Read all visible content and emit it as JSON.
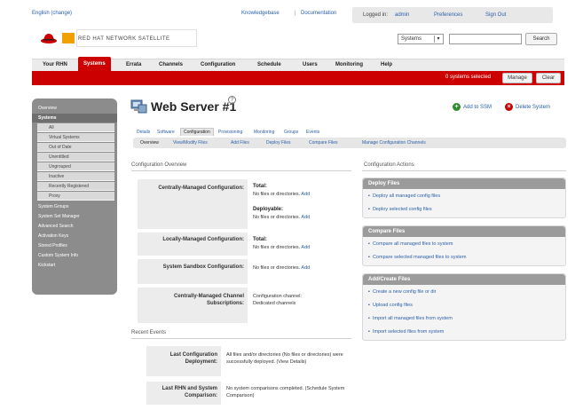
{
  "topbar": {
    "language": "English (change)",
    "knowledgebase": "Knowledgebase",
    "documentation": "Documentation",
    "separator": "|",
    "logged_in": "Logged in:",
    "user": "admin",
    "preferences": "Preferences",
    "sign_out": "Sign Out"
  },
  "brand": {
    "logo_text": "RED HAT NETWORK SATELLITE"
  },
  "search": {
    "scope": "Systems",
    "button": "Search"
  },
  "mainnav": {
    "tabs": [
      "Your RHN",
      "Systems",
      "Errata",
      "Channels",
      "Configuration",
      "Schedule",
      "Users",
      "Monitoring",
      "Help"
    ]
  },
  "redbar": {
    "selected": "0 systems selected",
    "manage": "Manage",
    "clear": "Clear"
  },
  "sidebar": {
    "items": [
      "Overview",
      "Systems"
    ],
    "subitems": [
      "All",
      "Virtual Systems",
      "Out of Date",
      "Unentitled",
      "Ungrouped",
      "Inactive",
      "Recently Registered",
      "Proxy"
    ],
    "more": [
      "System Groups",
      "System Set Manager",
      "Advanced Search",
      "Activation Keys",
      "Stored Profiles",
      "Custom System Info",
      "Kickstart"
    ]
  },
  "server": {
    "title": "Web Server #1",
    "help": "?",
    "add_to_ssm": "Add to SSM",
    "delete_system": "Delete System"
  },
  "tabs1": [
    "Details",
    "Software",
    "Configuration",
    "Provisioning",
    "Monitoring",
    "Groups",
    "Events"
  ],
  "tabs2": [
    "Overview",
    "View/Modify Files",
    "Add Files",
    "Deploy Files",
    "Compare Files",
    "Manage Configuration Channels"
  ],
  "overview": {
    "heading": "Configuration Overview",
    "rows": [
      {
        "label": "Centrally-Managed Configuration:",
        "total_label": "Total:",
        "total_value": "No files or directories.",
        "total_link": "Add",
        "deploy_label": "Deployable:",
        "deploy_value": "No files or directories.",
        "deploy_link": "Add"
      },
      {
        "label": "Locally-Managed Configuration:",
        "total_label": "Total:",
        "value": "No files or directories.",
        "link": "Add"
      },
      {
        "label": "System Sandbox Configuration:",
        "value": "No files or directories.",
        "link": "Add"
      },
      {
        "label": "Centrally-Managed Channel Subscriptions:",
        "value": "Configuration channel: Dedicated channels"
      }
    ]
  },
  "events": {
    "heading": "Recent Events",
    "rows": [
      {
        "label": "Last Configuration Deployment:",
        "value": "All files and/or directories (No files or directories) were successfully deployed. (View Details)"
      },
      {
        "label": "Last RHN and System Comparison:",
        "value": "No system comparisons completed. (Schedule System Comparison)"
      }
    ]
  },
  "actions": {
    "heading": "Configuration Actions",
    "boxes": [
      {
        "title": "Deploy Files",
        "items": [
          "Deploy all managed config files",
          "Deploy selected config files"
        ]
      },
      {
        "title": "Compare Files",
        "items": [
          "Compare all managed files to system",
          "Compare selected managed files to system"
        ]
      },
      {
        "title": "Add/Create Files",
        "items": [
          "Create a new config file or dir",
          "Upload config files",
          "Import all managed files from system",
          "Import selected files from system"
        ]
      }
    ]
  },
  "colors": {
    "brand_red": "#cc0000",
    "link_blue": "#2b5fa8",
    "sidebar_grey": "#8c8c8c",
    "add_green": "#2e8b2e"
  }
}
